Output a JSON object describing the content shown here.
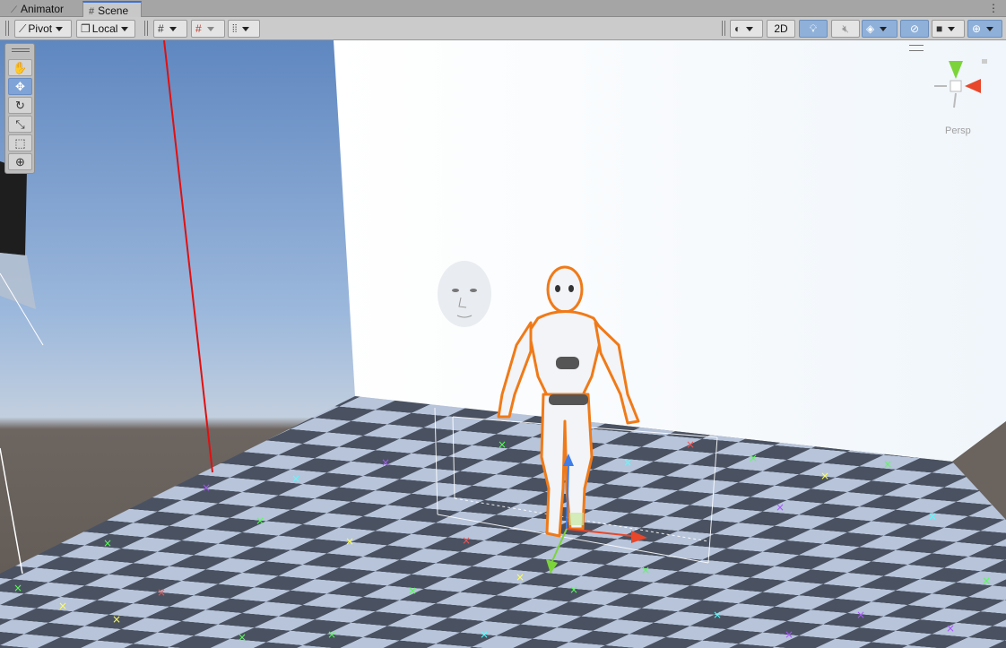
{
  "tabs": [
    {
      "label": "Animator",
      "icon": "animator-icon",
      "active": false
    },
    {
      "label": "Scene",
      "icon": "hash-icon",
      "active": true
    }
  ],
  "toolbar": {
    "pivot_label": "Pivot",
    "local_label": "Local",
    "twod_label": "2D"
  },
  "tools": [
    {
      "name": "hand-tool",
      "glyph": "✋",
      "active": false
    },
    {
      "name": "move-tool",
      "glyph": "✥",
      "active": true
    },
    {
      "name": "rotate-tool",
      "glyph": "↻",
      "active": false
    },
    {
      "name": "scale-tool",
      "glyph": "⤡",
      "active": false
    },
    {
      "name": "rect-tool",
      "glyph": "⬚",
      "active": false
    },
    {
      "name": "transform-tool",
      "glyph": "⊕",
      "active": false
    }
  ],
  "gizmo": {
    "projection_label": "Persp"
  },
  "colors": {
    "selection_outline": "#f07a18",
    "axis_x": "#e8472b",
    "axis_y": "#7cd43a",
    "axis_z": "#3f7de8",
    "active_tab_accent": "#3a72d8",
    "toolbar_active": "#8fb0d8"
  }
}
